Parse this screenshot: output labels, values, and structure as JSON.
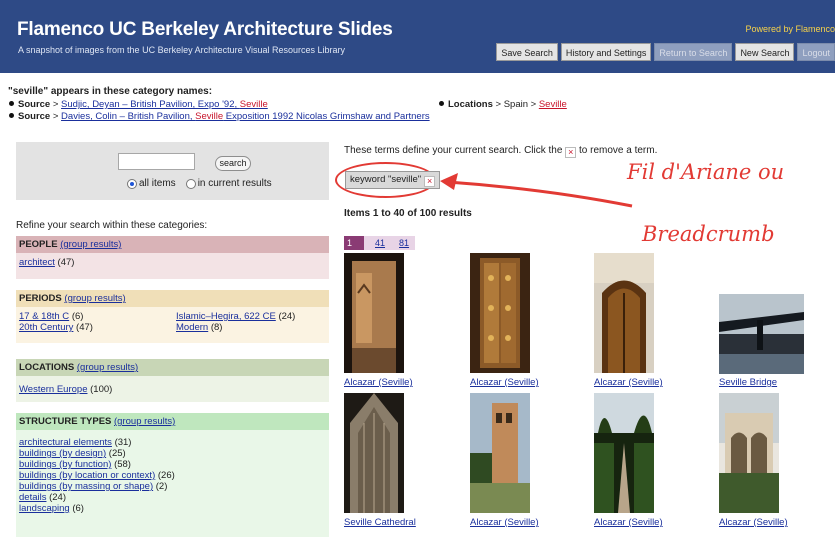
{
  "header": {
    "title": "Flamenco UC Berkeley Architecture Slides",
    "subtitle": "A snapshot of images from the UC Berkeley Architecture Visual Resources Library",
    "powered_by": "Powered by Flamenco",
    "buttons": [
      {
        "label": "Save Search",
        "disabled": false
      },
      {
        "label": "History and Settings",
        "disabled": false
      },
      {
        "label": "Return to Search",
        "disabled": true
      },
      {
        "label": "New Search",
        "disabled": false
      },
      {
        "label": "Logout",
        "disabled": true
      }
    ]
  },
  "category_names": {
    "heading": "\"seville\" appears in these category names:",
    "rows": [
      {
        "facet": "Source",
        "sep": " > ",
        "prefix": "Sudjic, Deyan – British Pavilion, Expo '92, ",
        "highlight": "Seville",
        "suffix": ""
      },
      {
        "facet": "Source",
        "sep": " > ",
        "prefix": "Davies, Colin – British Pavilion, ",
        "highlight": "Seville",
        "suffix": " Exposition 1992 Nicolas Grimshaw and Partners"
      }
    ],
    "locations": {
      "facet": "Locations",
      "path": " > Spain > ",
      "highlight": "Seville"
    }
  },
  "search": {
    "input_value": "",
    "button_label": "search",
    "scope_all": "all items",
    "scope_current": "in current results",
    "selected": "all items"
  },
  "refine_label": "Refine your search within these categories:",
  "facets": {
    "people": {
      "title": "PEOPLE",
      "group_link": "(group results)",
      "items": [
        {
          "name": "architect",
          "count": "(47)"
        }
      ]
    },
    "periods": {
      "title": "PERIODS",
      "group_link": "(group results)",
      "col1": [
        {
          "name": "17 & 18th C",
          "count": "(6)"
        },
        {
          "name": "20th Century",
          "count": "(47)"
        }
      ],
      "col2": [
        {
          "name": "Islamic–Hegira, 622 CE",
          "count": "(24)"
        },
        {
          "name": "Modern",
          "count": "(8)"
        }
      ]
    },
    "locations": {
      "title": "LOCATIONS",
      "group_link": "(group results)",
      "items": [
        {
          "name": "Western Europe",
          "count": "(100)"
        }
      ]
    },
    "structure": {
      "title": "STRUCTURE TYPES",
      "group_link": "(group results)",
      "items": [
        {
          "name": "architectural elements",
          "count": "(31)"
        },
        {
          "name": "buildings (by design)",
          "count": "(25)"
        },
        {
          "name": "buildings (by function)",
          "count": "(58)"
        },
        {
          "name": "buildings (by location or context)",
          "count": "(26)"
        },
        {
          "name": "buildings (by massing or shape)",
          "count": "(2)"
        },
        {
          "name": "details",
          "count": "(24)"
        },
        {
          "name": "landscaping",
          "count": "(6)"
        }
      ]
    }
  },
  "results": {
    "terms_note_before": "These terms define your current search. Click the",
    "terms_note_after": "to remove a term.",
    "remove_glyph": "×",
    "term_chip": "keyword \"seville\"",
    "items_count": "Items 1 to 40 of 100 results",
    "pages": [
      "1",
      "41",
      "81"
    ],
    "thumbs": [
      {
        "caption": "Alcazar (Seville)",
        "icon": "tower-photo"
      },
      {
        "caption": "Alcazar (Seville)",
        "icon": "door-photo"
      },
      {
        "caption": "Alcazar (Seville)",
        "icon": "arch-door-photo"
      },
      {
        "caption": "Seville Bridge",
        "icon": "bridge-photo"
      },
      {
        "caption": "Seville Cathedral",
        "icon": "cathedral-photo"
      },
      {
        "caption": "Alcazar (Seville)",
        "icon": "garden-tower-photo"
      },
      {
        "caption": "Alcazar (Seville)",
        "icon": "garden-path-photo"
      },
      {
        "caption": "Alcazar (Seville)",
        "icon": "courtyard-photo"
      }
    ]
  },
  "annotation": {
    "line1": "Fil d'Ariane ou",
    "line2": "Breadcrumb",
    "color": "#e23a34"
  },
  "colors": {
    "header_bg": "#2e4a86",
    "link": "#1a2f9c",
    "highlight": "#c8142b",
    "pager_current": "#8a3b74"
  }
}
